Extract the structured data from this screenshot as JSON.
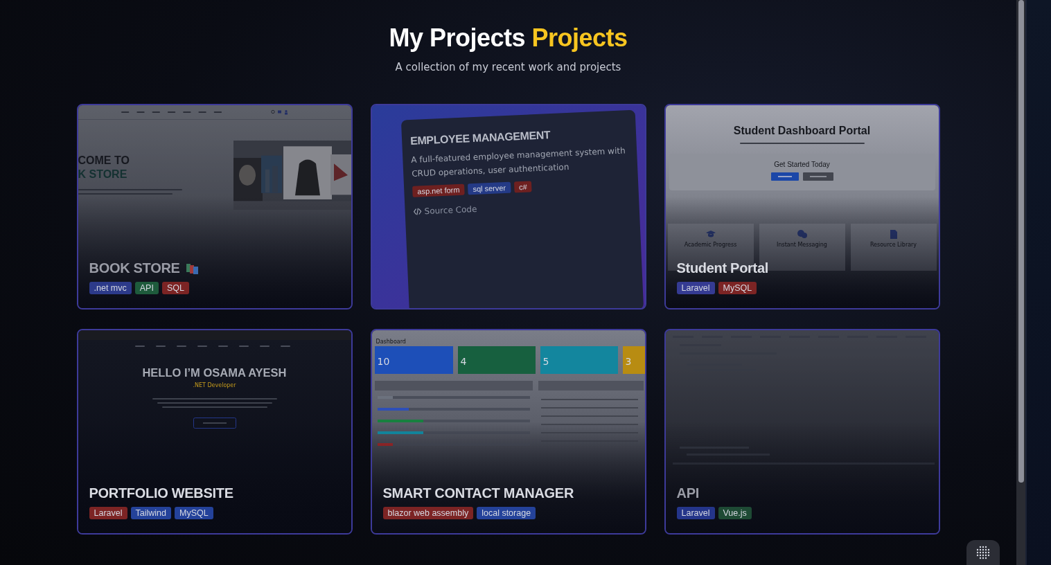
{
  "header": {
    "title": "My Projects",
    "title_accent": "Projects",
    "subtitle": "A collection of my recent work and projects"
  },
  "projects": [
    {
      "kind": "thumb",
      "title": "BOOK STORE",
      "dimmed": true,
      "tags": [
        {
          "label": ".net mvc",
          "color": "#2c3a8a"
        },
        {
          "label": "API",
          "color": "#1e5b3c"
        },
        {
          "label": "SQL",
          "color": "#7c2424"
        }
      ],
      "preview": {
        "kind": "bookstore",
        "heading": [
          "COME TO",
          "K STORE"
        ]
      }
    },
    {
      "kind": "details",
      "title": "EMPLOYEE MANAGEMENT",
      "description": "A full-featured employee management system with CRUD operations, user authentication",
      "dimmed": false,
      "tags": [
        {
          "label": "asp.net form",
          "color": "#6e2020"
        },
        {
          "label": "sql server",
          "color": "#243a86"
        },
        {
          "label": "c#",
          "color": "#6e2020"
        }
      ],
      "link": "Source Code",
      "preview": {
        "kind": "code"
      }
    },
    {
      "kind": "thumb",
      "title": "Student Portal",
      "dimmed": false,
      "tags": [
        {
          "label": "Laravel",
          "color": "#353b93"
        },
        {
          "label": "MySQL",
          "color": "#7c2424"
        }
      ],
      "preview": {
        "kind": "student",
        "title": "Student Dashboard Portal",
        "cta": "Get Started Today",
        "features": [
          "Academic Progress",
          "Instant Messaging",
          "Resource Library"
        ]
      }
    },
    {
      "kind": "thumb",
      "title": "PORTFOLIO WEBSITE",
      "dimmed": false,
      "tags": [
        {
          "label": "Laravel",
          "color": "#7c2424"
        },
        {
          "label": "Tailwind",
          "color": "#24429a"
        },
        {
          "label": "MySQL",
          "color": "#24429a"
        }
      ],
      "preview": {
        "kind": "portfolio",
        "heading": "HELLO I’M OSAMA AYESH",
        "role": ".NET Developer"
      }
    },
    {
      "kind": "thumb",
      "title": "SMART CONTACT MANAGER",
      "dimmed": false,
      "tags": [
        {
          "label": "blazor web assembly",
          "color": "#7c2424"
        },
        {
          "label": "local storage",
          "color": "#24429a"
        }
      ],
      "preview": {
        "kind": "dashboard",
        "heading": "Dashboard",
        "stats": [
          {
            "value": "10",
            "color": "#1d4fb8"
          },
          {
            "value": "4",
            "color": "#17603f"
          },
          {
            "value": "5",
            "color": "#13869e"
          },
          {
            "value": "3",
            "color": "#b88c12"
          }
        ]
      }
    },
    {
      "kind": "thumb",
      "title": "API",
      "dimmed": true,
      "tags": [
        {
          "label": "Laravel",
          "color": "#24358a"
        },
        {
          "label": "Vue.js",
          "color": "#1e4a34"
        }
      ],
      "preview": {
        "kind": "api"
      }
    }
  ]
}
